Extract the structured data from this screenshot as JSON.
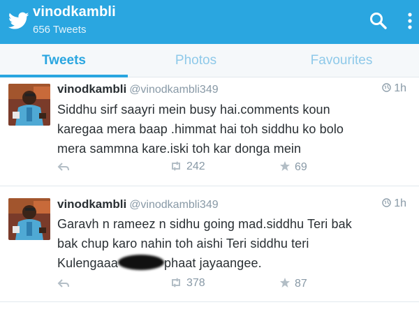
{
  "header": {
    "title": "vinodkambli",
    "subtitle": "656 Tweets",
    "icons": [
      "twitter-bird-icon",
      "search-icon",
      "more-vert-icon"
    ]
  },
  "tabs": [
    {
      "label": "Tweets",
      "active": true
    },
    {
      "label": "Photos",
      "active": false
    },
    {
      "label": "Favourites",
      "active": false
    }
  ],
  "colors": {
    "brand": "#2aa6e0",
    "muted": "#8899a6",
    "text": "#292f33"
  },
  "tweets": [
    {
      "name": "vinodkambli",
      "handle": "@vinodkambli349",
      "time": "1h",
      "lines": [
        "Siddhu sirf saayri mein  busy hai.comments koun",
        "karegaa mera baap .himmat hai toh siddhu ko bolo",
        "mera sammna kare.iski toh kar donga mein"
      ],
      "retweets": "242",
      "favorites": "69"
    },
    {
      "name": "vinodkambli",
      "handle": "@vinodkambli349",
      "time": "1h",
      "lines": [
        "Garavh n rameez n sidhu going mad.siddhu Teri bak",
        "bak chup karo nahin toh aishi Teri siddhu teri"
      ],
      "line3_before": "Kulengaaa",
      "line3_after": "phaat jayaangee.",
      "retweets": "378",
      "favorites": "87"
    }
  ]
}
